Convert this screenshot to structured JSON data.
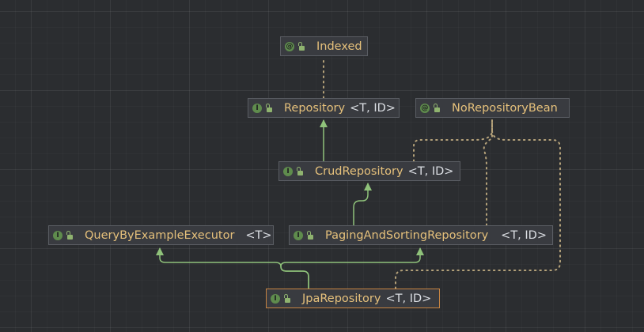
{
  "nodes": {
    "indexed": {
      "kind": "@",
      "kind_label": "annotation",
      "name": "Indexed",
      "params": ""
    },
    "repository": {
      "kind": "I",
      "kind_label": "interface",
      "name": "Repository",
      "params": "<T, ID>"
    },
    "no_repository_bean": {
      "kind": "@",
      "kind_label": "annotation",
      "name": "NoRepositoryBean",
      "params": ""
    },
    "crud_repository": {
      "kind": "I",
      "kind_label": "interface",
      "name": "CrudRepository",
      "params": "<T, ID>"
    },
    "query_by_example_executor": {
      "kind": "I",
      "kind_label": "interface",
      "name": "QueryByExampleExecutor",
      "params": "<T>"
    },
    "paging_and_sorting_repository": {
      "kind": "I",
      "kind_label": "interface",
      "name": "PagingAndSortingRepository",
      "params": "<T, ID>"
    },
    "jpa_repository": {
      "kind": "I",
      "kind_label": "interface",
      "name": "JpaRepository",
      "params": "<T, ID>",
      "selected": true
    }
  },
  "edges": [
    {
      "from": "repository",
      "to": "indexed",
      "style": "annotated"
    },
    {
      "from": "crud_repository",
      "to": "repository",
      "style": "extends"
    },
    {
      "from": "paging_and_sorting_repository",
      "to": "crud_repository",
      "style": "extends"
    },
    {
      "from": "jpa_repository",
      "to": "query_by_example_executor",
      "style": "extends"
    },
    {
      "from": "jpa_repository",
      "to": "paging_and_sorting_repository",
      "style": "extends"
    },
    {
      "from": "crud_repository",
      "to": "no_repository_bean",
      "style": "annotated"
    },
    {
      "from": "paging_and_sorting_repository",
      "to": "no_repository_bean",
      "style": "annotated"
    },
    {
      "from": "jpa_repository",
      "to": "no_repository_bean",
      "style": "annotated"
    }
  ],
  "colors": {
    "background": "#2b2d30",
    "node_fill": "#393b40",
    "node_border": "#5a5d63",
    "selected_border": "#c78442",
    "class_name": "#e5c07b",
    "extends_edge": "#8fc27a",
    "annotation_edge": "#b5a27a"
  }
}
